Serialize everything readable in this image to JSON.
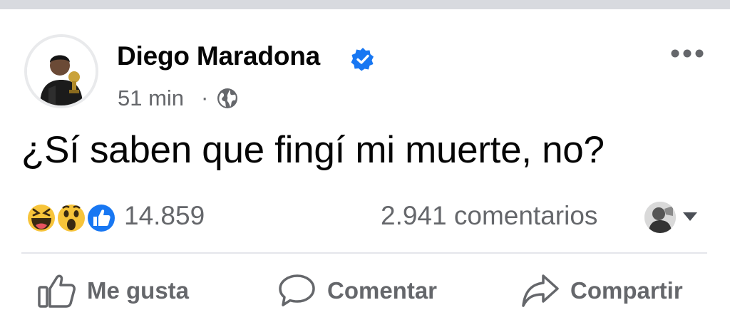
{
  "post": {
    "author": "Diego Maradona",
    "timestamp": "51 min",
    "separator": "·",
    "text": "¿Sí saben que fingí mi muerte, no?"
  },
  "stats": {
    "reaction_count": "14.859",
    "comments_label": "2.941 comentarios"
  },
  "actions": {
    "like_label": "Me gusta",
    "comment_label": "Comentar",
    "share_label": "Compartir"
  },
  "icons": {
    "verified": "verified-badge-icon",
    "more": "more-options-icon",
    "privacy": "globe-icon",
    "reactions": [
      "haha-reaction-icon",
      "wow-reaction-icon",
      "like-reaction-icon"
    ],
    "like": "thumbs-up-icon",
    "comment": "speech-bubble-icon",
    "share": "share-arrow-icon"
  },
  "colors": {
    "accent": "#1877f2",
    "secondary_text": "#65676b",
    "primary_text": "#050505"
  }
}
